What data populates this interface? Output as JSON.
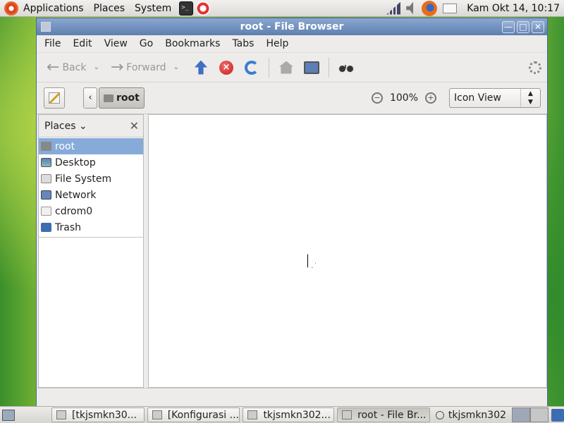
{
  "top_panel": {
    "menus": [
      "Applications",
      "Places",
      "System"
    ],
    "clock": "Kam Okt 14, 10:17"
  },
  "window": {
    "title": "root - File Browser",
    "menubar": [
      "File",
      "Edit",
      "View",
      "Go",
      "Bookmarks",
      "Tabs",
      "Help"
    ],
    "toolbar": {
      "back_label": "Back",
      "forward_label": "Forward"
    },
    "location": {
      "current_folder": "root",
      "zoom": "100%",
      "view_mode": "Icon View"
    },
    "sidebar": {
      "header": "Places",
      "items": [
        {
          "label": "root",
          "icon": "home-folder-icon",
          "selected": true
        },
        {
          "label": "Desktop",
          "icon": "desktop-icon",
          "selected": false
        },
        {
          "label": "File System",
          "icon": "drive-icon",
          "selected": false
        },
        {
          "label": "Network",
          "icon": "network-icon",
          "selected": false
        },
        {
          "label": "cdrom0",
          "icon": "cdrom-icon",
          "selected": false
        },
        {
          "label": "Trash",
          "icon": "trash-icon",
          "selected": false
        }
      ]
    }
  },
  "taskbar": {
    "tasks": [
      {
        "label": "[tkjsmkn30..."
      },
      {
        "label": "[Konfigurasi ..."
      },
      {
        "label": "tkjsmkn302..."
      },
      {
        "label": "root - File Br..."
      }
    ],
    "user": "tkjsmkn302"
  },
  "colors": {
    "titlebar": "#6f8fbf",
    "selection": "#86abd9",
    "stop": "#c91d1d",
    "accent": "#3f6ec2"
  }
}
